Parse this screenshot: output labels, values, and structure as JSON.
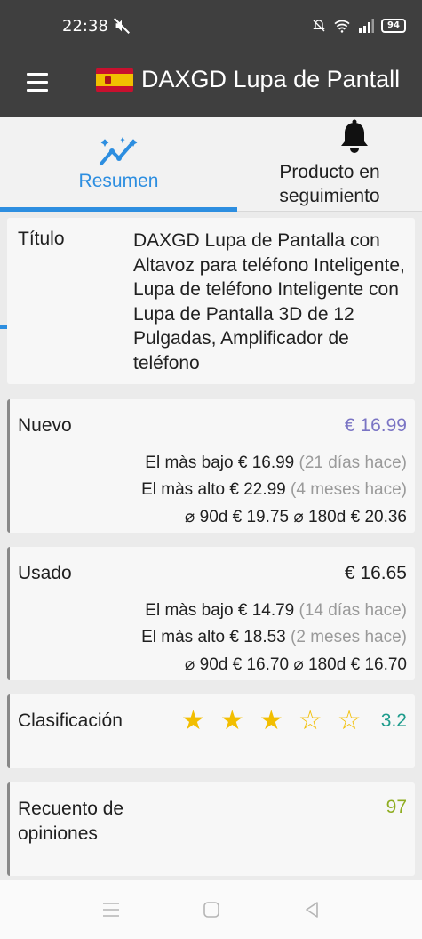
{
  "status_bar": {
    "time": "22:38",
    "battery": "94",
    "icons": [
      "mute-icon",
      "alarm-off-icon",
      "wifi-icon",
      "signal-icon",
      "battery-icon"
    ]
  },
  "app_bar": {
    "title": "DAXGD Lupa de Pantall",
    "flag": "spain-flag-icon"
  },
  "tabs": [
    {
      "label": "Resumen",
      "icon": "chart-trend-icon",
      "active": true
    },
    {
      "label": "Producto en seguimiento",
      "icon": "bell-icon",
      "active": false
    }
  ],
  "details": {
    "title_label": "Título",
    "title_value": "DAXGD Lupa de Pantalla con Altavoz para teléfono Inteligente, Lupa de teléfono Inteligente con Lupa de Pantalla 3D de 12 Pulgadas, Amplificador de teléfono"
  },
  "new": {
    "label": "Nuevo",
    "price": "€ 16.99",
    "lowest_label": "El màs bajo",
    "lowest_value": "€ 16.99",
    "lowest_when": "(21 días hace)",
    "highest_label": "El màs alto",
    "highest_value": "€ 22.99",
    "highest_when": "(4 meses hace)",
    "avg90_label": "⌀ 90d",
    "avg90_value": "€ 19.75",
    "avg180_label": "⌀ 180d",
    "avg180_value": "€ 20.36",
    "accent": "#8a85cf"
  },
  "used": {
    "label": "Usado",
    "price": "€ 16.65",
    "lowest_label": "El màs bajo",
    "lowest_value": "€ 14.79",
    "lowest_when": "(14 días hace)",
    "highest_label": "El màs alto",
    "highest_value": "€ 18.53",
    "highest_when": "(2 meses hace)",
    "avg90_label": "⌀ 90d",
    "avg90_value": "€ 16.70",
    "avg180_label": "⌀ 180d",
    "avg180_value": "€ 16.70",
    "accent": "#333333"
  },
  "rating": {
    "label": "Clasificación",
    "value": "3.2",
    "stars_filled": 3,
    "stars_total": 5,
    "accent": "#1e9c8c"
  },
  "reviews": {
    "label": "Recuento de opiniones",
    "value": "97",
    "accent": "#a3b831"
  },
  "nav": [
    "recents-icon",
    "home-icon",
    "back-icon"
  ]
}
